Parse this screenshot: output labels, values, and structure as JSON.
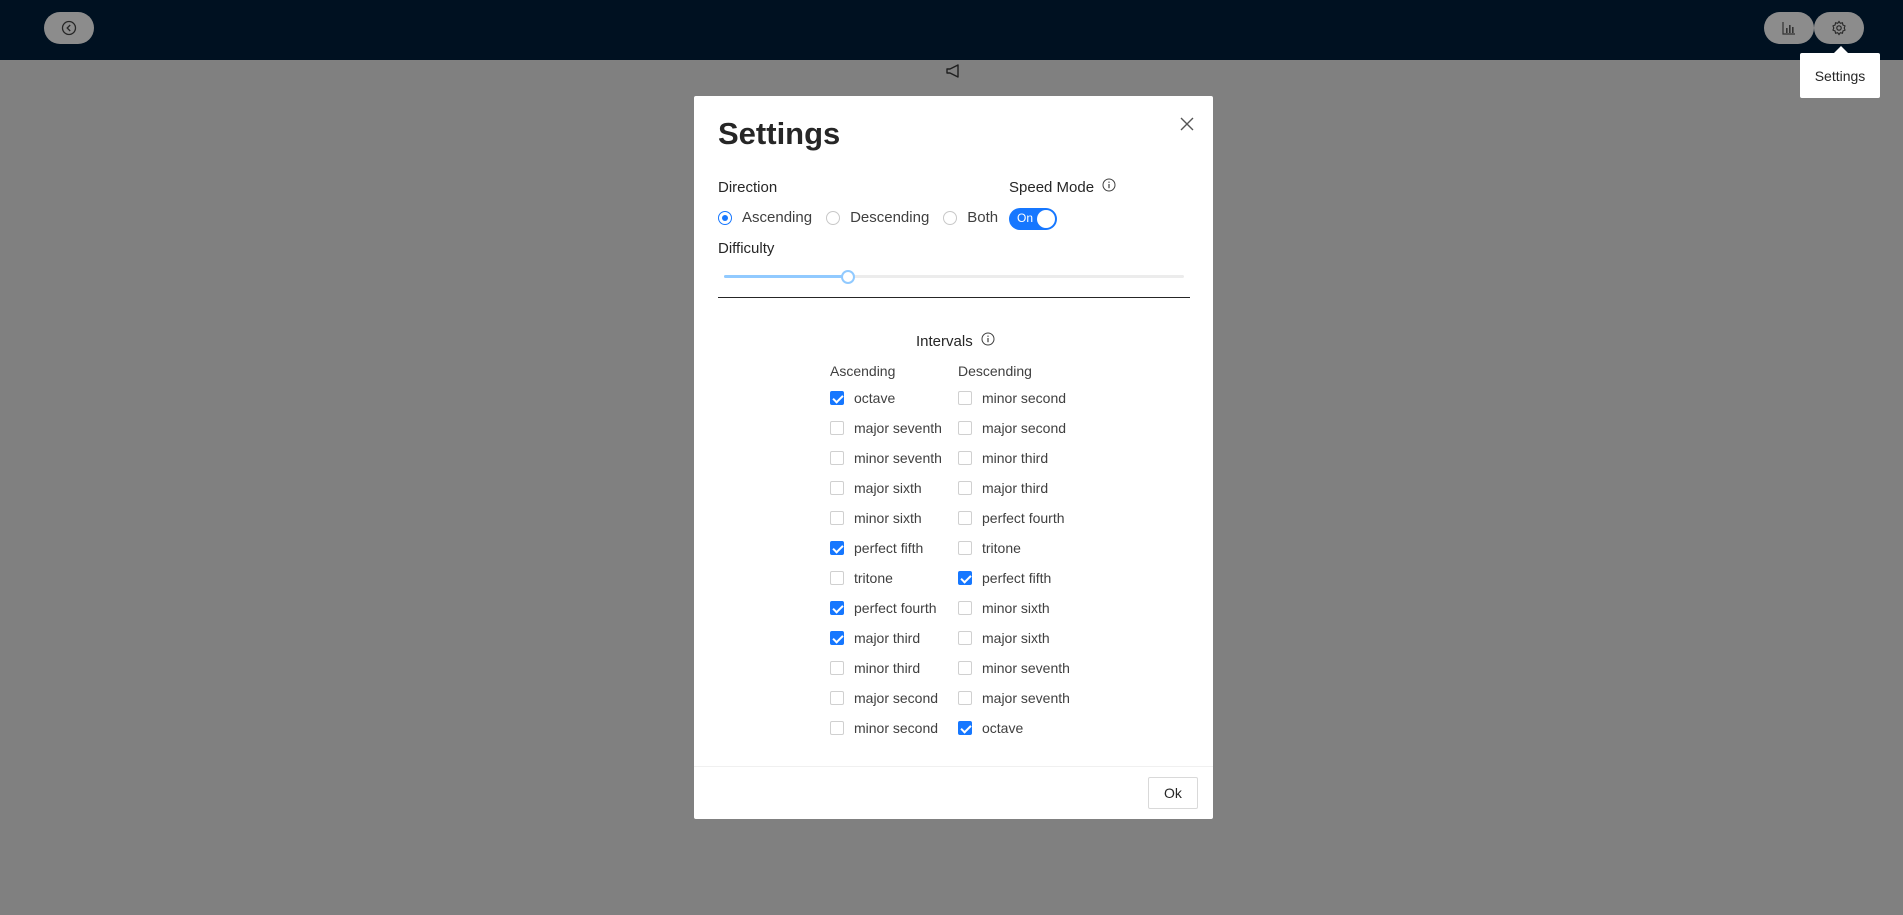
{
  "tooltip": {
    "text": "Settings"
  },
  "modal": {
    "title": "Settings",
    "direction": {
      "label": "Direction",
      "options": [
        {
          "label": "Ascending",
          "checked": true
        },
        {
          "label": "Descending",
          "checked": false
        },
        {
          "label": "Both",
          "checked": false
        }
      ]
    },
    "speed_mode": {
      "label": "Speed Mode",
      "switch_text": "On",
      "enabled": true
    },
    "difficulty": {
      "label": "Difficulty",
      "value_fraction": 0.27
    },
    "intervals": {
      "label": "Intervals",
      "ascending_header": "Ascending",
      "descending_header": "Descending",
      "ascending": [
        {
          "label": "octave",
          "checked": true
        },
        {
          "label": "major seventh",
          "checked": false
        },
        {
          "label": "minor seventh",
          "checked": false
        },
        {
          "label": "major sixth",
          "checked": false
        },
        {
          "label": "minor sixth",
          "checked": false
        },
        {
          "label": "perfect fifth",
          "checked": true
        },
        {
          "label": "tritone",
          "checked": false
        },
        {
          "label": "perfect fourth",
          "checked": true
        },
        {
          "label": "major third",
          "checked": true
        },
        {
          "label": "minor third",
          "checked": false
        },
        {
          "label": "major second",
          "checked": false
        },
        {
          "label": "minor second",
          "checked": false
        }
      ],
      "descending": [
        {
          "label": "minor second",
          "checked": false
        },
        {
          "label": "major second",
          "checked": false
        },
        {
          "label": "minor third",
          "checked": false
        },
        {
          "label": "major third",
          "checked": false
        },
        {
          "label": "perfect fourth",
          "checked": false
        },
        {
          "label": "tritone",
          "checked": false
        },
        {
          "label": "perfect fifth",
          "checked": true
        },
        {
          "label": "minor sixth",
          "checked": false
        },
        {
          "label": "major sixth",
          "checked": false
        },
        {
          "label": "minor seventh",
          "checked": false
        },
        {
          "label": "major seventh",
          "checked": false
        },
        {
          "label": "octave",
          "checked": true
        }
      ]
    },
    "ok_label": "Ok"
  },
  "colors": {
    "topbar": "#001121",
    "accent": "#1677ff",
    "overlay": "#808080"
  },
  "icons": [
    "back-icon",
    "bar-chart-icon",
    "gear-icon",
    "speaker-icon",
    "close-icon",
    "info-icon"
  ]
}
